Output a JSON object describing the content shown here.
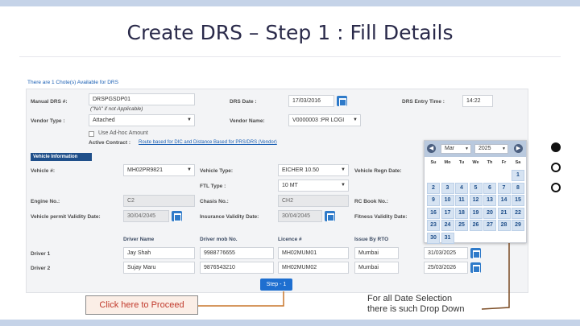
{
  "slide": {
    "title": "Create DRS – Step 1 : Fill Details"
  },
  "form": {
    "notice": "There are 1 Chote(s) Available for DRS",
    "manual_drs_label": "Manual DRS #:",
    "manual_drs_value": "DRSPGSDP01",
    "manual_drs_hint": "(\"NA\" if not Applicable)",
    "drs_date_label": "DRS Date :",
    "drs_date_value": "17/03/2016",
    "drs_time_label": "DRS Entry Time :",
    "drs_time_value": "14:22",
    "vendor_type_label": "Vendor Type :",
    "vendor_type_value": "Attached",
    "vendor_name_label": "Vendor Name:",
    "vendor_name_value": "V0000003 :PR LOGI",
    "adhoc_label": "Use Ad-hoc Amount",
    "active_contract_label": "Active Contract :",
    "active_contract_link": "Route based for DIC and Distance Based for PRS/DRS (Vendor)",
    "vehicle_info_header": "Vehicle Information",
    "vehicle_no_label": "Vehicle #:",
    "vehicle_no_value": "MH02PR9821",
    "vehicle_type_label": "Vehicle Type:",
    "vehicle_type_value": "EICHER 10.50",
    "vehicle_regn_label": "Vehicle Regn Date:",
    "ftl_type_label": "FTL Type :",
    "ftl_type_value": "10 MT",
    "engine_no_label": "Engine No.:",
    "engine_no_value": "C2",
    "chasis_no_label": "Chasis No.:",
    "chasis_no_value": "CH2",
    "rc_book_label": "RC Book No.:",
    "permit_label": "Vehicle permit Validity Date:",
    "permit_value": "30/04/2045",
    "insurance_label": "Insurance Validity Date:",
    "insurance_value": "30/04/2045",
    "fitness_label": "Fitness Validity Date:",
    "col_driver_name": "Driver Name",
    "col_driver_mob": "Driver mob No.",
    "col_licence": "Licence #",
    "col_issue_by": "Issue By RTO",
    "drivers": [
      {
        "label": "Driver 1",
        "name": "Jay Shah",
        "mobile": "9988776655",
        "licence": "MH02MUM01",
        "rto": "Mumbai",
        "date": "31/03/2025"
      },
      {
        "label": "Driver 2",
        "name": "Sujay Maru",
        "mobile": "9876543210",
        "licence": "MH02MUM02",
        "rto": "Mumbai",
        "date": "25/03/2026"
      }
    ],
    "step_button": "Step - 1"
  },
  "datepicker": {
    "month": "Mar",
    "year": "2025",
    "weekdays": [
      "Su",
      "Mo",
      "Tu",
      "We",
      "Th",
      "Fr",
      "Sa"
    ],
    "weeks": [
      [
        "",
        "",
        "",
        "",
        "",
        "",
        "1"
      ],
      [
        "2",
        "3",
        "4",
        "5",
        "6",
        "7",
        "8"
      ],
      [
        "9",
        "10",
        "11",
        "12",
        "13",
        "14",
        "15"
      ],
      [
        "16",
        "17",
        "18",
        "19",
        "20",
        "21",
        "22"
      ],
      [
        "23",
        "24",
        "25",
        "26",
        "27",
        "28",
        "29"
      ],
      [
        "30",
        "31",
        "",
        "",
        "",
        "",
        ""
      ]
    ]
  },
  "annotations": {
    "proceed_callout": "Click here to Proceed",
    "date_note_line1": "For all Date Selection",
    "date_note_line2": "there is such Drop Down"
  },
  "colors": {
    "accent_blue": "#1e6fd0",
    "callout_red": "#c0392b",
    "callout_line": "#c8762c",
    "stripe": "#c5d3e8"
  }
}
